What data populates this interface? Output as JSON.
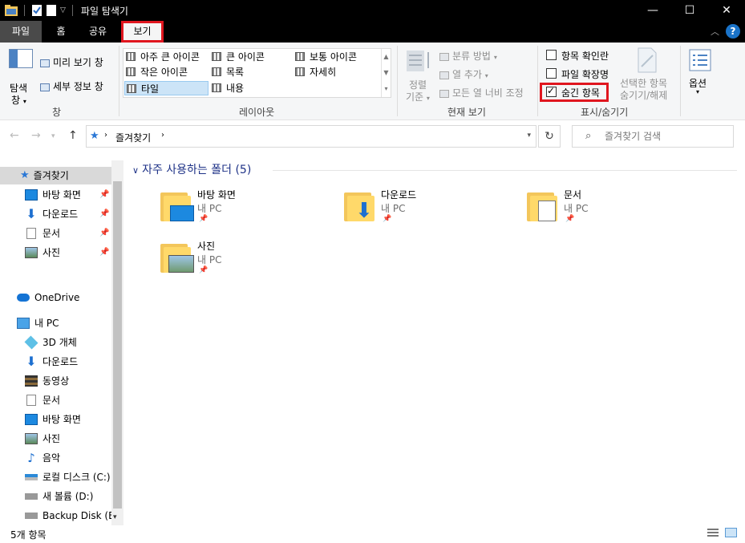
{
  "window": {
    "title": "파일 탐색기",
    "controls": {
      "minimize": "—",
      "maximize": "☐",
      "close": "✕"
    }
  },
  "tabs": {
    "file": "파일",
    "home": "홈",
    "share": "공유",
    "view": "보기"
  },
  "ribbon": {
    "pane": {
      "nav_pane": "탐색",
      "nav_pane2": "창",
      "preview": "미리 보기 창",
      "details": "세부 정보 창",
      "label": "창"
    },
    "layout": {
      "items": [
        "아주 큰 아이콘",
        "큰 아이콘",
        "보통 아이콘",
        "작은 아이콘",
        "목록",
        "자세히",
        "타일",
        "내용"
      ],
      "label": "레이아웃"
    },
    "current_view": {
      "sort": "정렬",
      "sort2": "기준",
      "group_by": "분류 방법",
      "add_column": "열 추가",
      "fit_columns": "모든 열 너비 조정",
      "label": "현재 보기"
    },
    "show_hide": {
      "item_checkboxes": "항목 확인란",
      "file_extensions": "파일 확장명",
      "hidden_items": "숨긴 항목",
      "hidden_items_checked": true,
      "hide_selected": "선택한 항목",
      "hide_selected2": "숨기기/해제",
      "label": "표시/숨기기"
    },
    "options": "옵션"
  },
  "address": {
    "path_root": "즐겨찾기",
    "search_placeholder": "즐겨찾기 검색"
  },
  "sidebar": {
    "quick_access": "즐겨찾기",
    "qa_items": [
      "바탕 화면",
      "다운로드",
      "문서",
      "사진"
    ],
    "onedrive": "OneDrive",
    "this_pc": "내 PC",
    "pc_items": [
      "3D 개체",
      "다운로드",
      "동영상",
      "문서",
      "바탕 화면",
      "사진",
      "음악",
      "로컬 디스크 (C:)",
      "새 볼륨 (D:)",
      "Backup Disk (E:)"
    ]
  },
  "content": {
    "group_title": "자주 사용하는 폴더 (5)",
    "tiles": [
      {
        "name": "바탕 화면",
        "location": "내 PC"
      },
      {
        "name": "다운로드",
        "location": "내 PC"
      },
      {
        "name": "문서",
        "location": "내 PC"
      },
      {
        "name": "사진",
        "location": "내 PC"
      }
    ]
  },
  "status": {
    "count": "5개 항목"
  },
  "colors": {
    "accent_blue": "#1e3287",
    "highlight_red": "#e0161f",
    "selected_bg": "#cce4f7",
    "folder_yellow": "#ffd96a"
  }
}
